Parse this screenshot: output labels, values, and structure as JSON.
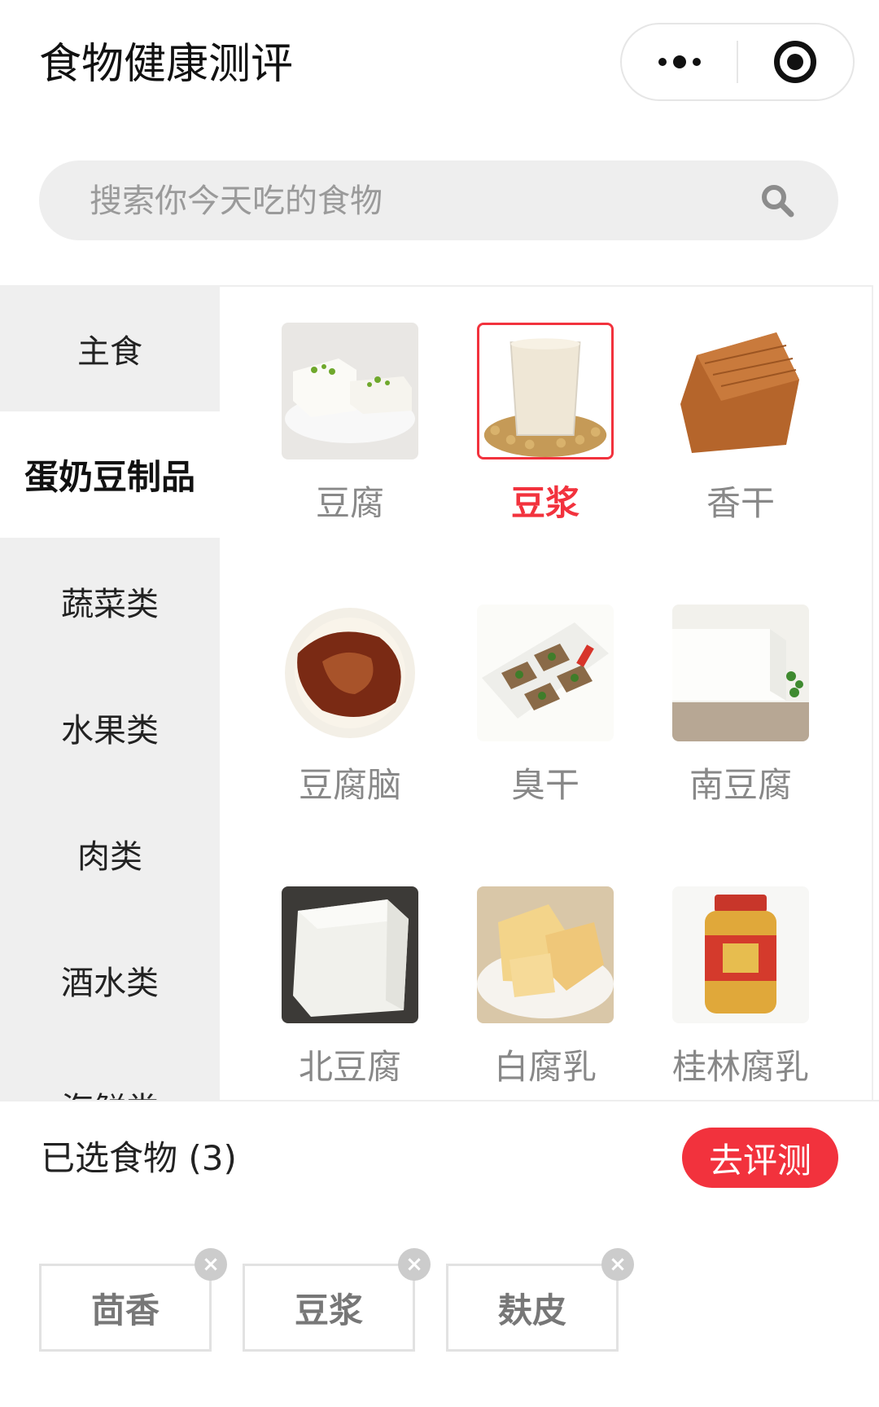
{
  "header": {
    "title": "食物健康测评",
    "more_icon": "more-dots-icon",
    "close_icon": "target-close-icon"
  },
  "search": {
    "placeholder": "搜索你今天吃的食物",
    "icon": "search-icon"
  },
  "sidebar": {
    "items": [
      {
        "label": "主食"
      },
      {
        "label": "蛋奶豆制品",
        "active": true
      },
      {
        "label": "蔬菜类"
      },
      {
        "label": "水果类"
      },
      {
        "label": "肉类"
      },
      {
        "label": "酒水类"
      },
      {
        "label": "海鲜类"
      }
    ]
  },
  "foods": [
    {
      "name": "豆腐"
    },
    {
      "name": "豆浆",
      "selected": true
    },
    {
      "name": "香干"
    },
    {
      "name": "豆腐脑"
    },
    {
      "name": "臭干"
    },
    {
      "name": "南豆腐"
    },
    {
      "name": "北豆腐"
    },
    {
      "name": "白腐乳"
    },
    {
      "name": "桂林腐乳"
    }
  ],
  "bottom": {
    "selected_label": "已选食物 (3)",
    "eval_button": "去评测",
    "chips": [
      {
        "label": "茴香"
      },
      {
        "label": "豆浆"
      },
      {
        "label": "麸皮"
      }
    ],
    "chip_close": "×"
  },
  "colors": {
    "accent": "#f2323d",
    "sidebar_bg": "#efefef",
    "search_bg": "#eeeeee",
    "muted_text": "#888888"
  }
}
